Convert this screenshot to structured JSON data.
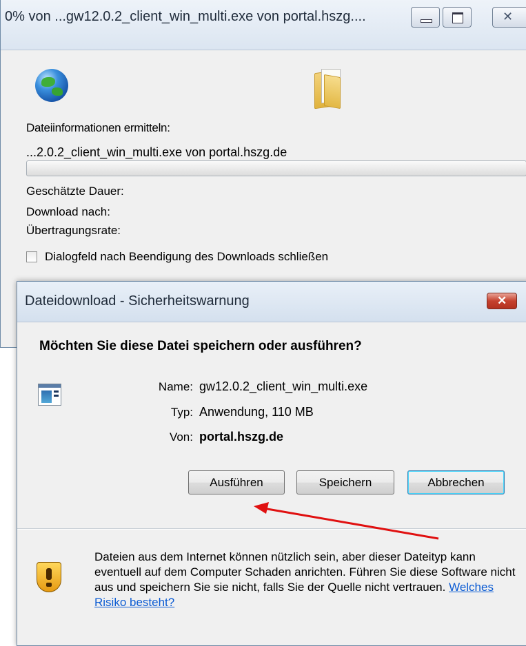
{
  "download_window": {
    "title": "0% von ...gw12.0.2_client_win_multi.exe von portal.hszg....",
    "status_label": "Dateiinformationen ermitteln:",
    "file_source": "...2.0.2_client_win_multi.exe von portal.hszg.de",
    "progress": 0,
    "estimated_time_label": "Geschätzte Dauer:",
    "download_to_label": "Download nach:",
    "transfer_rate_label": "Übertragungsrate:",
    "close_checkbox_label": "Dialogfeld nach Beendigung des Downloads schließen",
    "close_checkbox_checked": false,
    "icons": [
      "globe-icon",
      "folder-icon"
    ]
  },
  "security_dialog": {
    "title": "Dateidownload - Sicherheitswarnung",
    "question": "Möchten Sie diese Datei speichern oder ausführen?",
    "fields": {
      "name_label": "Name:",
      "name_value": "gw12.0.2_client_win_multi.exe",
      "type_label": "Typ:",
      "type_value": "Anwendung, 110 MB",
      "from_label": "Von:",
      "from_value": "portal.hszg.de"
    },
    "buttons": {
      "run": "Ausführen",
      "save": "Speichern",
      "cancel": "Abbrechen"
    },
    "warning_text": "Dateien aus dem Internet können nützlich sein, aber dieser Dateityp kann eventuell auf dem Computer Schaden anrichten. Führen Sie diese Software nicht aus und speichern Sie sie nicht, falls Sie der Quelle nicht vertrauen.",
    "warning_link": "Welches Risiko besteht?",
    "icons": [
      "application-icon",
      "shield-warning-icon"
    ]
  },
  "annotation": {
    "type": "arrow",
    "color": "#e01010",
    "points_to": "Ausführen"
  }
}
